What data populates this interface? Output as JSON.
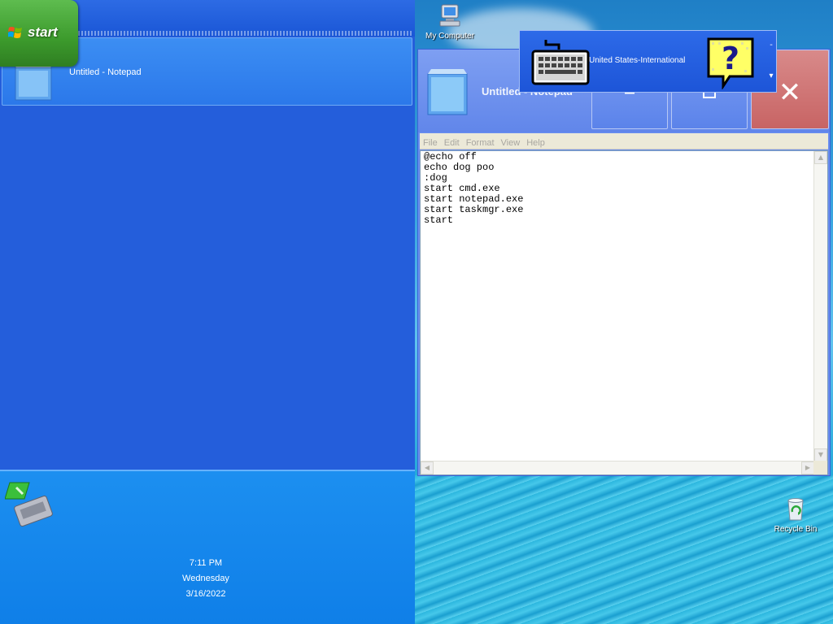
{
  "start_button": {
    "label": "start"
  },
  "taskbar": {
    "items": [
      {
        "label": "Untitled - Notepad",
        "icon": "notepad-icon"
      }
    ]
  },
  "tray": {
    "icons": [
      "network-icon"
    ],
    "clock": {
      "time": "7:11 PM",
      "day": "Wednesday",
      "date": "3/16/2022"
    }
  },
  "desktop": {
    "icons": [
      {
        "label": "My Computer",
        "icon": "my-computer-icon"
      },
      {
        "label": "Recycle Bin",
        "icon": "recycle-bin-icon"
      }
    ]
  },
  "notepad": {
    "title": "Untitled - Notepad",
    "menu": [
      "File",
      "Edit",
      "Format",
      "View",
      "Help"
    ],
    "content": "@echo off\necho dog poo\n:dog\nstart cmd.exe\nstart notepad.exe\nstart taskmgr.exe\nstart",
    "buttons": {
      "minimize": "minimize",
      "maximize": "maximize",
      "close": "close"
    },
    "close_glyph": "✕"
  },
  "language_bar": {
    "language": "United States-International",
    "minimize_glyph": "-",
    "options_glyph": "▾"
  },
  "colors": {
    "taskbar": "#245edb",
    "start_green": "#3c9a2c",
    "close_red": "#c86464"
  }
}
